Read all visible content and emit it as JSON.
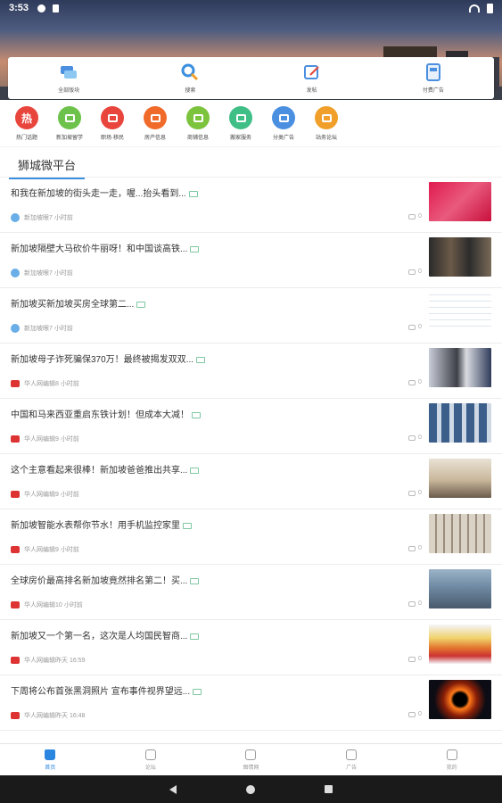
{
  "status_bar": {
    "time": "3:53"
  },
  "top_menu": [
    {
      "label": "全部版块",
      "icon": "chat-icon"
    },
    {
      "label": "搜索",
      "icon": "search-icon"
    },
    {
      "label": "发帖",
      "icon": "edit-icon"
    },
    {
      "label": "付费广告",
      "icon": "ad-icon"
    }
  ],
  "categories": [
    {
      "label": "热门话题",
      "icon": "hot-topic-icon",
      "color": "#e8453c",
      "glyph": "热"
    },
    {
      "label": "新加坡留学",
      "icon": "study-icon",
      "color": "#6cc24a"
    },
    {
      "label": "职场·移民",
      "icon": "career-icon",
      "color": "#e8453c"
    },
    {
      "label": "房产信息",
      "icon": "house-icon",
      "color": "#f06b2a"
    },
    {
      "label": "商铺信息",
      "icon": "shop-icon",
      "color": "#7cc33e"
    },
    {
      "label": "搬家服务",
      "icon": "moving-icon",
      "color": "#3fbf86"
    },
    {
      "label": "分类广告",
      "icon": "classified-icon",
      "color": "#4a8fe0"
    },
    {
      "label": "站务论坛",
      "icon": "forum-icon",
      "color": "#f0a02a"
    }
  ],
  "feed": {
    "section_title": "狮城微平台",
    "rows": [
      {
        "title": "和我在新加坡的街头走一走，喔...抬头看到...",
        "source": "新加坡眼",
        "time": "7 小时前",
        "comments": "0",
        "source_icon": "blue",
        "thumb": "thumb-pink"
      },
      {
        "title": "新加坡隔壁大马砍价牛丽呀！和中国谈高铁...",
        "source": "新加坡眼",
        "time": "7 小时前",
        "comments": "0",
        "source_icon": "blue",
        "thumb": "thumb-people"
      },
      {
        "title": "新加坡买新加坡买房全球第二...",
        "source": "新加坡眼",
        "time": "7 小时前",
        "comments": "0",
        "source_icon": "blue",
        "thumb": "thumb-table"
      },
      {
        "title": "新加坡母子诈死骗保370万！最终被揭发双双...",
        "source": "华人网编辑",
        "time": "8 小时前",
        "comments": "0",
        "source_icon": "red",
        "thumb": "thumb-masks"
      },
      {
        "title": "中国和马来西亚重启东铁计划！但成本大减！",
        "source": "华人网编辑",
        "time": "9 小时前",
        "comments": "0",
        "source_icon": "red",
        "thumb": "thumb-sign"
      },
      {
        "title": "这个主意看起来很棒！新加坡爸爸推出共享...",
        "source": "华人网编辑",
        "time": "9 小时前",
        "comments": "0",
        "source_icon": "red",
        "thumb": "thumb-shelf"
      },
      {
        "title": "新加坡智能水表帮你节水！用手机监控家里",
        "source": "华人网编辑",
        "time": "9 小时前",
        "comments": "0",
        "source_icon": "red",
        "thumb": "thumb-pipes"
      },
      {
        "title": "全球房价最高排名新加坡竟然排名第二！买...",
        "source": "华人网编辑",
        "time": "10 小时前",
        "comments": "0",
        "source_icon": "red",
        "thumb": "thumb-city"
      },
      {
        "title": "新加坡又一个第一名，这次是人均国民智商...",
        "source": "华人网编辑",
        "time": "昨天 16:59",
        "comments": "0",
        "source_icon": "red",
        "thumb": "thumb-map"
      },
      {
        "title": "下周将公布首张黑洞照片 宣布事件视界望远...",
        "source": "华人网编辑",
        "time": "昨天 16:48",
        "comments": "0",
        "source_icon": "red",
        "thumb": "thumb-blackhole"
      }
    ]
  },
  "bottom_nav": [
    {
      "label": "首页",
      "icon": "home-icon",
      "active": true
    },
    {
      "label": "论坛",
      "icon": "forum-icon",
      "active": false
    },
    {
      "label": "图情网",
      "icon": "camera-icon",
      "active": false
    },
    {
      "label": "广告",
      "icon": "gift-icon",
      "active": false
    },
    {
      "label": "我的",
      "icon": "user-icon",
      "active": false
    }
  ],
  "colors": {
    "accent": "#2b86e0"
  }
}
